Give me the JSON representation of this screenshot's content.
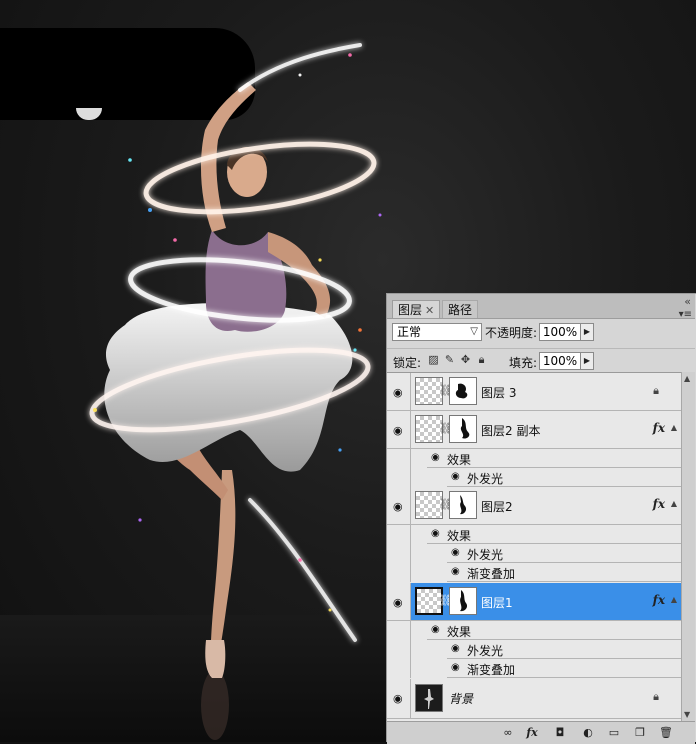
{
  "layers_panel": {
    "tabs": [
      {
        "label": "图层",
        "active": true
      },
      {
        "label": "路径",
        "active": false
      }
    ],
    "blend_mode": "正常",
    "opacity_label": "不透明度:",
    "opacity_value": "100%",
    "lock_label": "锁定:",
    "fill_label": "填充:",
    "fill_value": "100%",
    "layers": [
      {
        "name": "图层 3",
        "effects": false,
        "locked": true
      },
      {
        "name": "图层2 副本",
        "effects": true,
        "effects_label": "效果",
        "effect_items": [
          "外发光"
        ]
      },
      {
        "name": "图层2",
        "effects": true,
        "effects_label": "效果",
        "effect_items": [
          "外发光",
          "渐变叠加"
        ]
      },
      {
        "name": "图层1",
        "effects": true,
        "selected": true,
        "effects_label": "效果",
        "effect_items": [
          "外发光",
          "渐变叠加"
        ]
      },
      {
        "name": "背景",
        "locked": true
      }
    ],
    "fx_label": "fx",
    "selection_color": "#3a8fe8"
  },
  "bottom_icons": [
    "link-icon",
    "fx-icon",
    "mask-icon",
    "adjustment-icon",
    "folder-icon",
    "new-layer-icon",
    "trash-icon"
  ]
}
